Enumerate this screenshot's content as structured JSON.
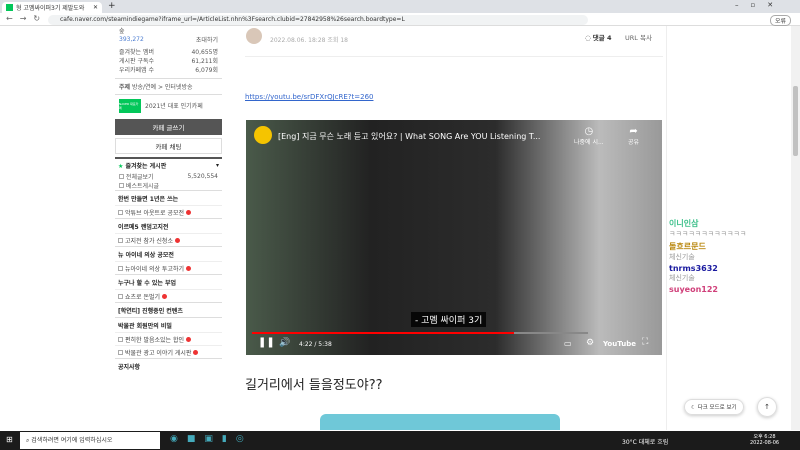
{
  "browser": {
    "tab_title": "형 고멤싸이퍼3기 제발도와",
    "url": "cafe.naver.com/steamindiegame?iframe_url=/ArticleList.nhn%3Fsearch.clubid=27842958%26search.boardtype=L",
    "profile_label": "오류"
  },
  "sidebar": {
    "cafe_level": "숲",
    "members": "393,272",
    "invite": "초대하기",
    "stats": [
      {
        "label": "즐겨찾는 멤버",
        "value": "40,655명"
      },
      {
        "label": "게시판 구독수",
        "value": "61,211회"
      },
      {
        "label": "우리카페앱 수",
        "value": "6,079회"
      }
    ],
    "topic_label": "주제",
    "topic": "방송/연예 > 인터넷방송",
    "badge": "NAVER 대표카페",
    "award": "2021년 대표 인기카페",
    "write_button": "카페 글쓰기",
    "chat_button": "카페 채팅",
    "fav_header": "즐겨찾는 게시판",
    "all_posts": "전체글보기",
    "all_count": "5,520,554",
    "best": "베스트게시글",
    "groups": [
      {
        "header": "한번 만들면 1년은 쓰는",
        "items": [
          "악튜브 아웃트로 공모전"
        ]
      },
      {
        "header": "이르메5 랜덤고지전",
        "items": [
          "고지전 참가 신청소"
        ]
      },
      {
        "header": "뉴 아이네 의상 공모전",
        "items": [
          "뉴아이네 의상 투고하기"
        ]
      },
      {
        "header": "누구나 할 수 있는 부업",
        "items": [
          "쇼츠로 돈벌기"
        ]
      },
      {
        "header": "[학연티] 진행중인 컨텐츠",
        "items": []
      },
      {
        "header": "박물관 회원만의 비밀",
        "items": [
          "편히한 발음소있는 합인",
          "박물관 광고 이야기 게시판"
        ]
      }
    ],
    "notice": "공지사항"
  },
  "article": {
    "meta": "2022.08.06. 18:28  조회 18",
    "comments": "댓글 4",
    "url_copy": "URL 복사",
    "link": "https://youtu.be/srDFXrQJcRE?t=260",
    "heading": "길거리에서 들을정도야??"
  },
  "video": {
    "title": "[Eng] 지금 무슨 노래 듣고 있어요? | What SONG Are YOU Listening T...",
    "watch_later": "나중에 시...",
    "share": "공유",
    "caption": "- 고멤 싸이퍼 3기",
    "time": "4:22 / 5:38",
    "progress": 0.78,
    "brand": "YouTube"
  },
  "chat": {
    "messages": [
      {
        "user": "이니인삼",
        "text": "ㅋㅋㅋㅋㅋㅋㅋㅋㅋㅋㅋㅋ",
        "color": "#3cc08a"
      },
      {
        "user": "돌흐르문드",
        "text": "체신기술",
        "color": "#b8860b"
      },
      {
        "user": "tnrms3632",
        "text": "체신기술",
        "color": "#1a1aa0"
      },
      {
        "user": "suyeon122",
        "text": "",
        "color": "#d0407a"
      }
    ],
    "dark_mode": "다크 모드로 보기",
    "top": "↑"
  },
  "taskbar": {
    "search": "검색하려면 여기에 입력하십시오",
    "weather": "30°C 대체로 흐림",
    "time": "오후 6:28",
    "date": "2022-08-06"
  }
}
